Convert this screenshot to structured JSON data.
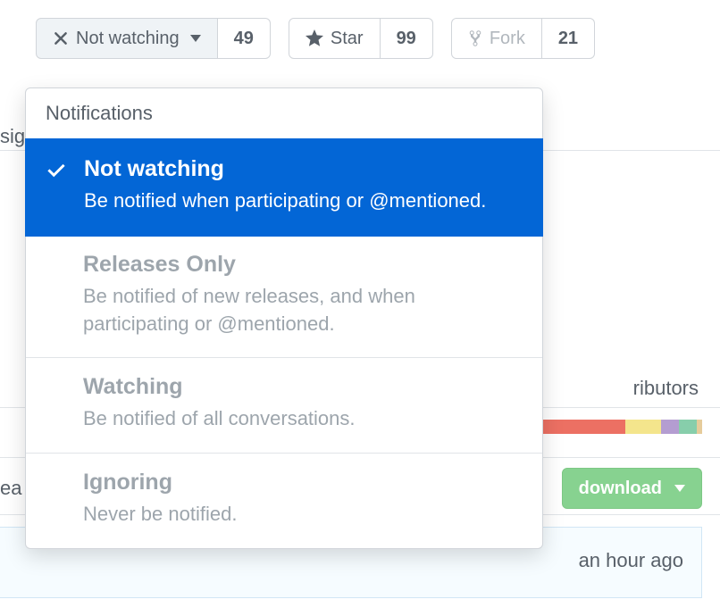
{
  "toolbar": {
    "watch": {
      "label": "Not watching",
      "count": "49"
    },
    "star": {
      "label": "Star",
      "count": "99"
    },
    "fork": {
      "label": "Fork",
      "count": "21"
    }
  },
  "dropdown": {
    "header": "Notifications",
    "items": [
      {
        "title": "Not watching",
        "desc": "Be notified when participating or @mentioned.",
        "selected": true
      },
      {
        "title": "Releases Only",
        "desc": "Be notified of new releases, and when participating or @mentioned.",
        "selected": false
      },
      {
        "title": "Watching",
        "desc": "Be notified of all conversations.",
        "selected": false
      },
      {
        "title": "Ignoring",
        "desc": "Never be notified.",
        "selected": false
      }
    ]
  },
  "background": {
    "contributors": "ributors",
    "download_label": "download",
    "time_ago": "an hour ago",
    "partial_left_1": "sig",
    "partial_left_2": "ea"
  },
  "colors": {
    "bar": [
      "#ec7063",
      "#f4e58c",
      "#b49dd1",
      "#87ceab",
      "#e6cc9b"
    ]
  }
}
